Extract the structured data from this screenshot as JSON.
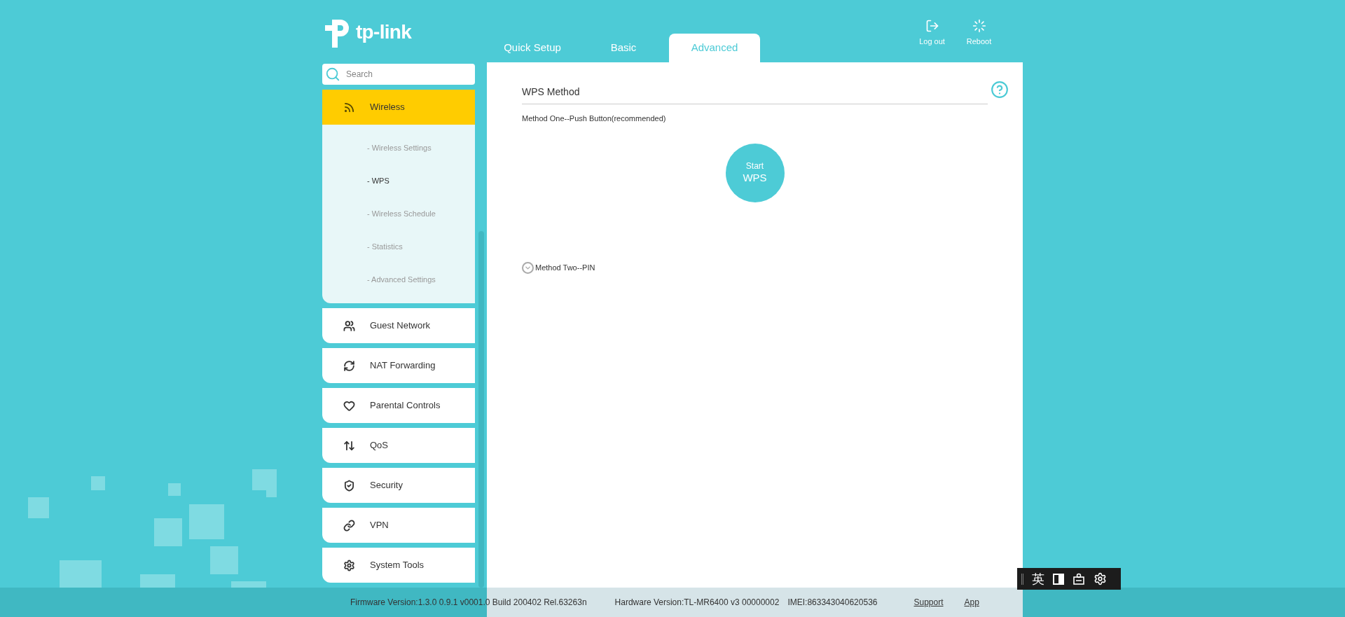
{
  "logo": {
    "text": "tp-link"
  },
  "tabs": [
    {
      "label": "Quick Setup",
      "selected": false
    },
    {
      "label": "Basic",
      "selected": false
    },
    {
      "label": "Advanced",
      "selected": true
    }
  ],
  "header_actions": [
    {
      "label": "Log out",
      "kind": "logout"
    },
    {
      "label": "Reboot",
      "kind": "reboot"
    }
  ],
  "search": {
    "placeholder": "Search"
  },
  "sidebar": {
    "items": [
      {
        "label": "Wireless",
        "kind": "wireless",
        "selected": true,
        "expanded": true,
        "children": [
          {
            "label": "- Wireless Settings",
            "selected": false
          },
          {
            "label": "- WPS",
            "selected": true
          },
          {
            "label": "- Wireless Schedule",
            "selected": false
          },
          {
            "label": "- Statistics",
            "selected": false
          },
          {
            "label": "- Advanced Settings",
            "selected": false
          }
        ]
      },
      {
        "label": "Guest Network",
        "kind": "guest",
        "selected": false,
        "expanded": false
      },
      {
        "label": "NAT Forwarding",
        "kind": "nat",
        "selected": false,
        "expanded": false
      },
      {
        "label": "Parental Controls",
        "kind": "parental",
        "selected": false,
        "expanded": false
      },
      {
        "label": "QoS",
        "kind": "qos",
        "selected": false,
        "expanded": false
      },
      {
        "label": "Security",
        "kind": "security",
        "selected": false,
        "expanded": false
      },
      {
        "label": "VPN",
        "kind": "vpn",
        "selected": false,
        "expanded": false
      },
      {
        "label": "System Tools",
        "kind": "tools",
        "selected": false,
        "expanded": false
      }
    ]
  },
  "content": {
    "title": "WPS Method",
    "method_one": "Method One--Push Button(recommended)",
    "start_button": {
      "line1": "Start",
      "line2": "WPS"
    },
    "method_two": {
      "label": "Method Two--PIN",
      "expanded": false
    }
  },
  "footer": {
    "firmware": "Firmware Version:1.3.0 0.9.1 v0001.0 Build 200402 Rel.63263n",
    "hardware": "Hardware Version:TL-MR6400 v3 00000002",
    "imei": "IMEI:863343040620536",
    "links": [
      "Support",
      "App"
    ]
  },
  "ime_toolbar": {
    "language": "英"
  }
}
